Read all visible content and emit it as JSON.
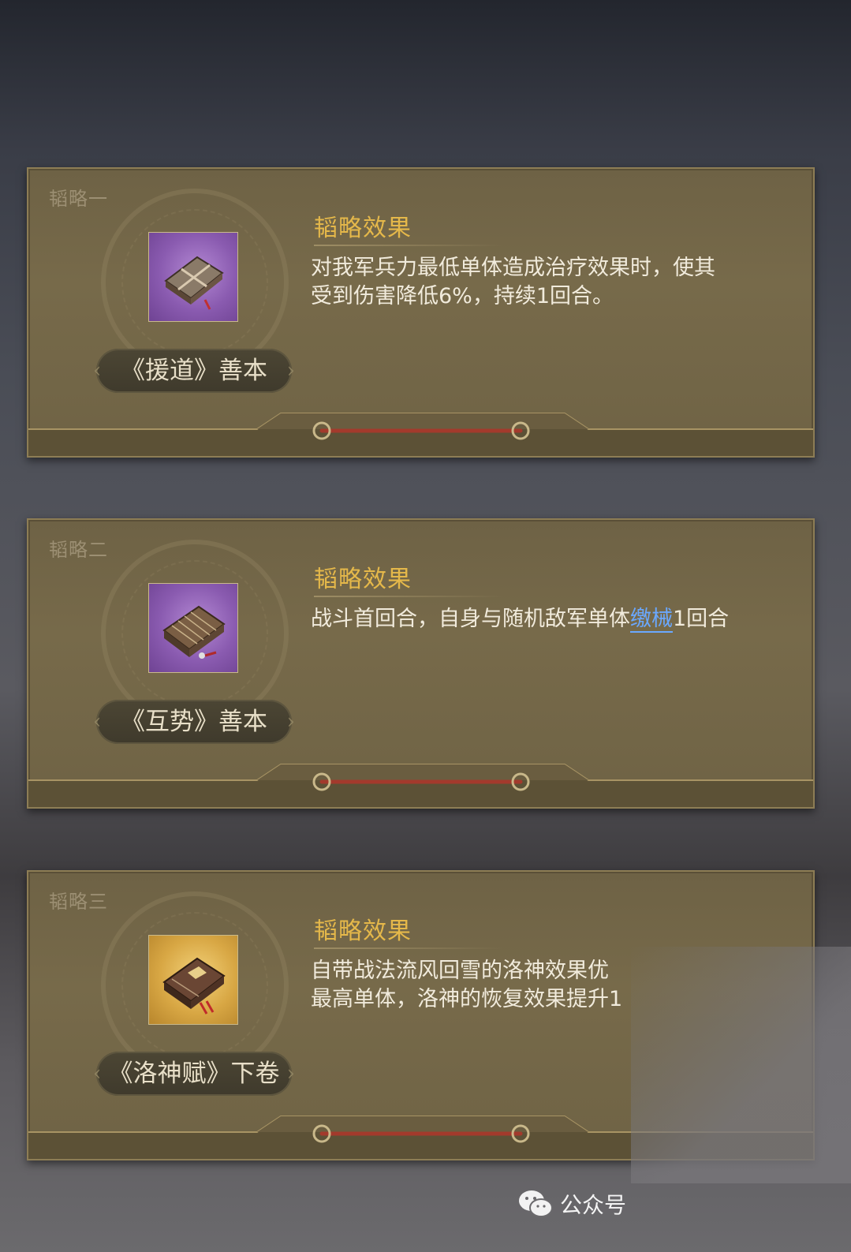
{
  "cards": [
    {
      "tag": "韬略一",
      "book_name": "《援道》善本",
      "book_icon": "purple-scroll-book-icon",
      "effect_title": "韬略效果",
      "effect_text_1": "对我军兵力最低单体造成治疗效果时，使其",
      "effect_text_2": "受到伤害降低6%，持续1回合。"
    },
    {
      "tag": "韬略二",
      "book_name": "《互势》善本",
      "book_icon": "purple-bamboo-book-icon",
      "effect_title": "韬略效果",
      "effect_text_pre": "战斗首回合，自身与随机敌军单体",
      "effect_text_link": "缴械",
      "effect_text_post": "1回合"
    },
    {
      "tag": "韬略三",
      "book_name": "《洛神赋》下卷",
      "book_icon": "gold-scroll-book-icon",
      "effect_title": "韬略效果",
      "effect_text_1": "自带战法流风回雪的洛神效果优",
      "effect_text_2": "最高单体，洛神的恢复效果提升1"
    }
  ],
  "watermark": {
    "label": "公众号",
    "icon": "wechat-icon"
  },
  "colors": {
    "effect_title": "#e5b84a",
    "link": "#6aa8ff",
    "panel": "#776a4a"
  }
}
